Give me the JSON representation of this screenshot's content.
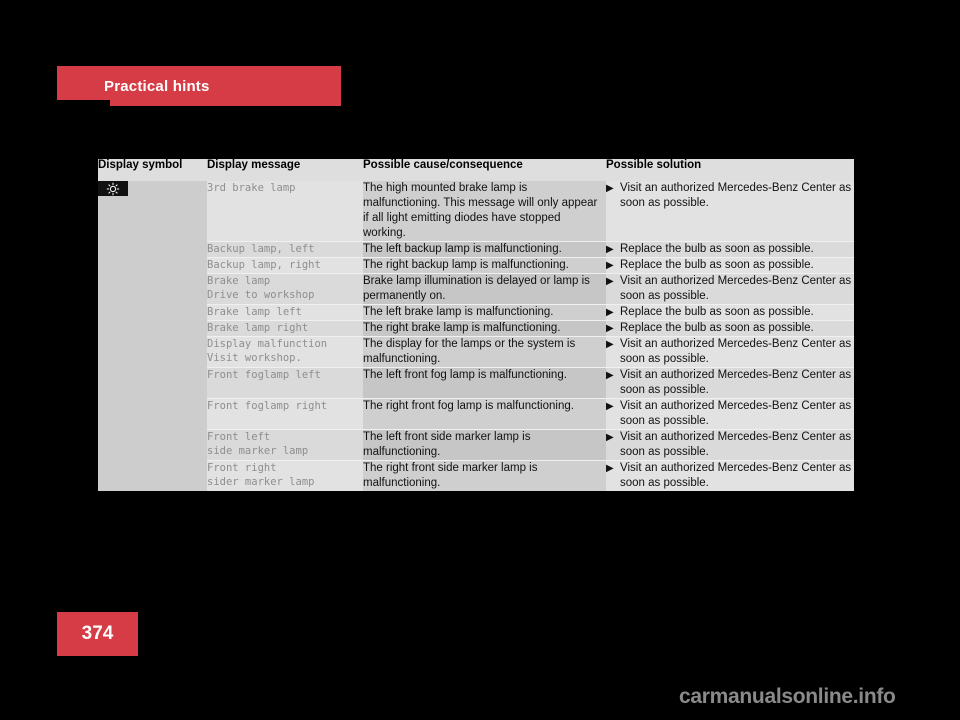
{
  "header": {
    "title": "Practical hints",
    "accent_color": "#d63c46"
  },
  "page_number": "374",
  "watermark": "carmanualsonline.info",
  "table": {
    "columns": [
      "Display symbol",
      "Display message",
      "Possible cause/consequence",
      "Possible solution"
    ],
    "symbol": {
      "icon_name": "brake-lamp-indicator-icon",
      "background": "#111111"
    },
    "bullet_glyph": "▶",
    "rows": [
      {
        "message_lines": [
          "3rd brake lamp"
        ],
        "cause": "The high mounted brake lamp is malfunctioning. This message will only appear if all light emitting diodes have stopped working.",
        "solution": "Visit an authorized Mercedes-Benz Center as soon as possible."
      },
      {
        "message_lines": [
          "Backup lamp, left"
        ],
        "cause": "The left backup lamp is malfunctioning.",
        "solution": "Replace the bulb as soon as possible."
      },
      {
        "message_lines": [
          "Backup lamp, right"
        ],
        "cause": "The right backup lamp is malfunctioning.",
        "solution": "Replace the bulb as soon as possible."
      },
      {
        "message_lines": [
          "Brake lamp",
          "Drive to workshop"
        ],
        "cause": "Brake lamp illumination is delayed or lamp is permanently on.",
        "solution": "Visit an authorized Mercedes-Benz Center as soon as possible."
      },
      {
        "message_lines": [
          "Brake lamp left"
        ],
        "cause": "The left brake lamp is malfunctioning.",
        "solution": "Replace the bulb as soon as possible."
      },
      {
        "message_lines": [
          "Brake lamp right"
        ],
        "cause": "The right brake lamp is malfunctioning.",
        "solution": "Replace the bulb as soon as possible."
      },
      {
        "message_lines": [
          "Display malfunction",
          "Visit workshop."
        ],
        "cause": "The display for the lamps or the system is malfunctioning.",
        "solution": "Visit an authorized Mercedes-Benz Center as soon as possible."
      },
      {
        "message_lines": [
          "Front foglamp left"
        ],
        "cause": "The left front fog lamp is malfunctioning.",
        "solution": "Visit an authorized Mercedes-Benz Center as soon as possible."
      },
      {
        "message_lines": [
          "Front foglamp right"
        ],
        "cause": "The right front fog lamp is malfunctioning.",
        "solution": "Visit an authorized Mercedes-Benz Center as soon as possible."
      },
      {
        "message_lines": [
          "Front left",
          "side marker lamp"
        ],
        "cause": "The left front side marker lamp is malfunctioning.",
        "solution": "Visit an authorized Mercedes-Benz Center as soon as possible."
      },
      {
        "message_lines": [
          "Front right",
          "sider marker lamp"
        ],
        "cause": "The right front side marker lamp is malfunctioning.",
        "solution": "Visit an authorized Mercedes-Benz Center as soon as possible."
      }
    ]
  }
}
